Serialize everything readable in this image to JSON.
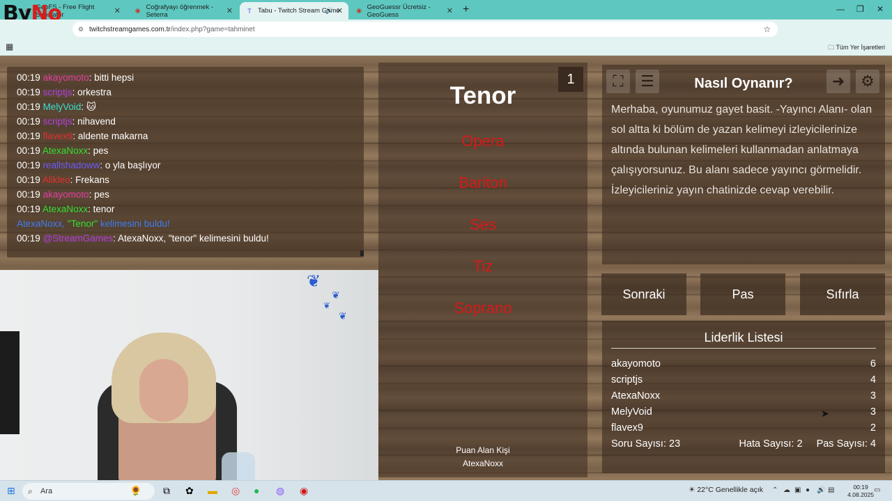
{
  "browser": {
    "tabs": [
      {
        "label": "GeoFS - Free Flight Simulator",
        "active": false
      },
      {
        "label": "Coğrafyayı öğrenmek - Seterra",
        "active": false
      },
      {
        "label": "Tabu - Twitch Stream Game",
        "active": true
      },
      {
        "label": "GeoGuessr Ücretsiz - GeoGuess",
        "active": false
      }
    ],
    "url_host": "twitchstreamgames.com.tr",
    "url_path": "/index.php?game=tahminet",
    "bookmarks_label": "Tüm Yer İşaretleri"
  },
  "overlay_logo": {
    "text_a": "By",
    "text_b": "No"
  },
  "chat": {
    "messages": [
      {
        "time": "00:19",
        "user": "akayomoto",
        "color": "#e040a0",
        "text": ": bitti hepsi"
      },
      {
        "time": "00:19",
        "user": "scriptjs",
        "color": "#b040e0",
        "text": ": orkestra"
      },
      {
        "time": "00:19",
        "user": "MelyVoid",
        "color": "#39e0d0",
        "text": ": 🐱"
      },
      {
        "time": "00:19",
        "user": "scriptjs",
        "color": "#b040e0",
        "text": ": nihavend"
      },
      {
        "time": "00:19",
        "user": "flavex9",
        "color": "#e03030",
        "text": ": aldente makarna"
      },
      {
        "time": "00:19",
        "user": "AtexaNoxx",
        "color": "#34e034",
        "text": ": pes"
      },
      {
        "time": "00:19",
        "user": "reallshadoww",
        "color": "#6a5cff",
        "text": ": o yla başlıyor"
      },
      {
        "time": "00:19",
        "user": "Alikleo",
        "color": "#e03030",
        "text": ": Frekans"
      },
      {
        "time": "00:19",
        "user": "akayomoto",
        "color": "#e040a0",
        "text": ": pes"
      },
      {
        "time": "00:19",
        "user": "AtexaNoxx",
        "color": "#34e034",
        "text": ": tenor"
      }
    ],
    "found_user": "AtexaNoxx,",
    "found_word": "\"Tenor\"",
    "found_suffix": " kelimesini buldu!",
    "bot_time": "00:19",
    "bot_user": "@StreamGames",
    "bot_text": ": AtexaNoxx, \"tenor\" kelimesini buldu!"
  },
  "card": {
    "count": "1",
    "word": "Tenor",
    "taboo": [
      "Opera",
      "Bariton",
      "Ses",
      "Tiz",
      "Soprano"
    ],
    "scorer_label": "Puan Alan Kişi",
    "scorer_name": "AtexaNoxx"
  },
  "info": {
    "title": "Nasıl Oynanır?",
    "text": "Merhaba, oyunumuz gayet basit. -Yayıncı Alanı- olan sol altta ki bölüm de yazan kelimeyi izleyicilerinize altında bulunan kelimeleri kullanmadan anlatmaya çalışıyorsunuz. Bu alanı sadece yayıncı görmelidir. İzleyicileriniz yayın chatinizde cevap verebilir."
  },
  "actions": {
    "next": "Sonraki",
    "pass": "Pas",
    "reset": "Sıfırla"
  },
  "leaderboard": {
    "title": "Liderlik Listesi",
    "rows": [
      {
        "name": "akayomoto",
        "score": "6"
      },
      {
        "name": "scriptjs",
        "score": "4"
      },
      {
        "name": "AtexaNoxx",
        "score": "3"
      },
      {
        "name": "MelyVoid",
        "score": "3"
      },
      {
        "name": "flavex9",
        "score": "2"
      }
    ],
    "questions": "Soru Sayısı: 23",
    "errors": "Hata Sayısı: 2",
    "passes": "Pas Sayısı: 4"
  },
  "taskbar": {
    "search": "Ara",
    "weather": "22°C  Genellikle açık",
    "time": "00:19",
    "date": "4.08.2025"
  }
}
